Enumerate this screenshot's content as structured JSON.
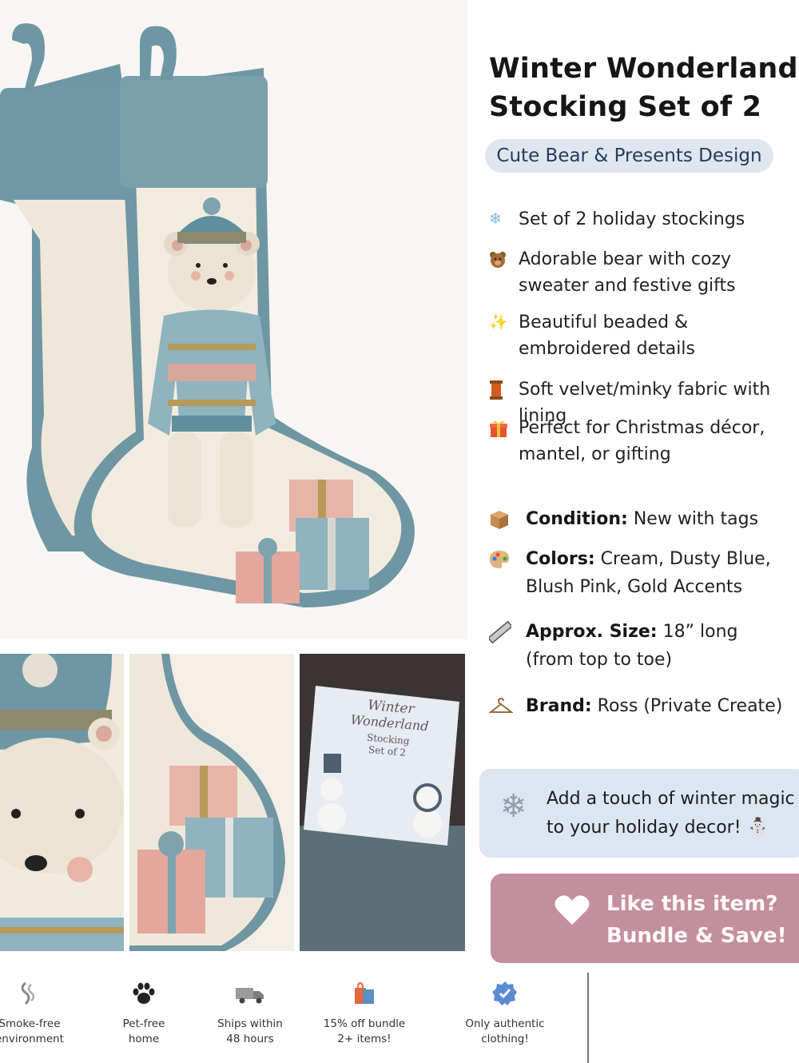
{
  "product": {
    "title": "Winter Wonderland Stocking Set of 2",
    "subtitle": "Cute Bear & Presents Design"
  },
  "features": [
    {
      "icon": "snowflake-icon",
      "text": "Set of 2 holiday stockings"
    },
    {
      "icon": "bear-icon",
      "text": "Adorable bear with cozy sweater and festive gifts"
    },
    {
      "icon": "sparkles-icon",
      "text": "Beautiful beaded & embroidered details"
    },
    {
      "icon": "thread-spool-icon",
      "text": "Soft velvet/minky fabric with lining"
    },
    {
      "icon": "gift-icon",
      "text": "Perfect for Christmas décor, mantel, or gifting"
    }
  ],
  "details": [
    {
      "icon": "box-icon",
      "label": "Condition:",
      "value": "New with tags"
    },
    {
      "icon": "palette-icon",
      "label": "Colors:",
      "value": "Cream, Dusty Blue, Blush Pink, Gold Accents"
    },
    {
      "icon": "ruler-icon",
      "label": "Approx. Size:",
      "value": "18” long (from top to toe)"
    },
    {
      "icon": "hanger-icon",
      "label": "Brand:",
      "value": "Ross (Private Create)"
    }
  ],
  "promo": {
    "text": "Add a touch of winter magic to your holiday decor! ⛄"
  },
  "bundle_button": {
    "line1": "Like this item?",
    "line2": "Bundle & Save!"
  },
  "badges": [
    {
      "icon": "smoke-icon",
      "line1": "Smoke-free",
      "line2": "environment"
    },
    {
      "icon": "paw-icon",
      "line1": "Pet-free",
      "line2": "home"
    },
    {
      "icon": "truck-icon",
      "line1": "Ships within",
      "line2": "48 hours"
    },
    {
      "icon": "shopping-bag-icon",
      "line1": "15% off bundle",
      "line2": "2+ items!"
    },
    {
      "icon": "verified-badge-icon",
      "line1": "Only authentic",
      "line2": "clothing!"
    }
  ],
  "packaging_card": {
    "line1": "Winter",
    "line2": "Wonderland",
    "line3": "Stocking",
    "line4": "Set of 2"
  },
  "colors": {
    "dusty_blue": "#6f96a3",
    "cream": "#f1ebdf",
    "blush_pink": "#e8b4a8",
    "gold": "#b59a5a",
    "pill_bg": "#dfe6ef",
    "promo_bg": "#dde5f0",
    "button_pink": "#c48f9d"
  }
}
